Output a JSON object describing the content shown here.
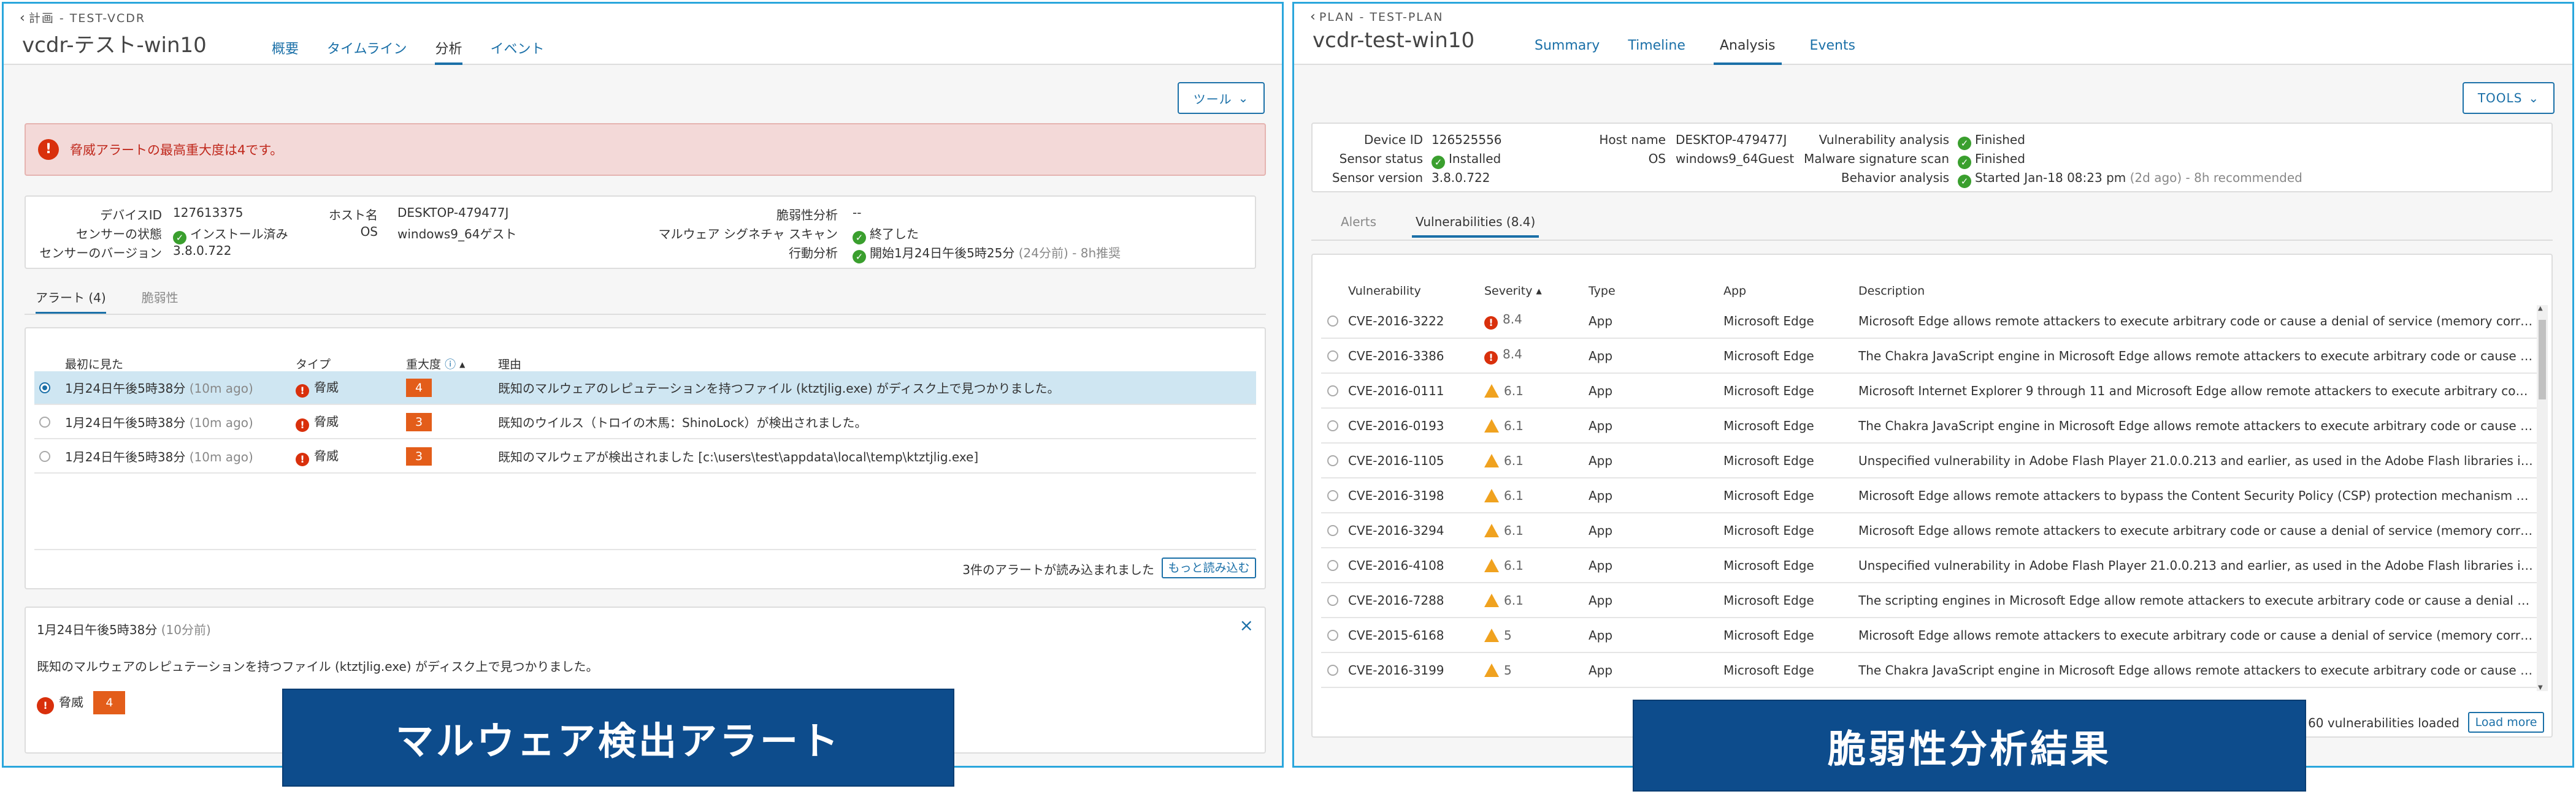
{
  "left": {
    "breadcrumb": "計画 - TEST-VCDR",
    "title": "vcdr-テスト-win10",
    "tabs": [
      "概要",
      "タイムライン",
      "分析",
      "イベント"
    ],
    "tools_label": "ツール",
    "alert_banner": "脅威アラートの最高重大度は4です。",
    "info": {
      "device_id_label": "デバイスID",
      "device_id": "127613375",
      "sensor_status_label": "センサーの状態",
      "sensor_status": "インストール済み",
      "sensor_version_label": "センサーのバージョン",
      "sensor_version": "3.8.0.722",
      "host_label": "ホスト名",
      "host": "DESKTOP-479477J",
      "os_label": "OS",
      "os": "windows9_64ゲスト",
      "vuln_label": "脆弱性分析",
      "vuln": "--",
      "malware_label": "マルウェア シグネチャ スキャン",
      "malware": "終了した",
      "behavior_label": "行動分析",
      "behavior": "開始1月24日午後5時25分",
      "behavior_ago": "(24分前)",
      "behavior_rec": " - 8h推奨"
    },
    "subtabs": [
      "アラート (4)",
      "脆弱性"
    ],
    "columns": [
      "最初に見た",
      "タイプ",
      "重大度",
      "理由"
    ],
    "rows": [
      {
        "time": "1月24日午後5時38分",
        "ago": "(10m ago)",
        "type": "脅威",
        "severity": "4",
        "reason": "既知のマルウェアのレピュテーションを持つファイル (ktztjlig.exe) がディスク上で見つかりました。"
      },
      {
        "time": "1月24日午後5時38分",
        "ago": "(10m ago)",
        "type": "脅威",
        "severity": "3",
        "reason": "既知のウイルス（トロイの木馬：ShinoLock）が検出されました。"
      },
      {
        "time": "1月24日午後5時38分",
        "ago": "(10m ago)",
        "type": "脅威",
        "severity": "3",
        "reason": "既知のマルウェアが検出されました [c:\\users\\test\\appdata\\local\\temp\\ktztjlig.exe]"
      }
    ],
    "loaded_text": "3件のアラートが読み込まれました",
    "load_more": "もっと読み込む",
    "detail": {
      "time": "1月24日午後5時38分",
      "ago": "(10分前)",
      "message": "既知のマルウェアのレピュテーションを持つファイル (ktztjlig.exe) がディスク上で見つかりました。",
      "type": "脅威",
      "severity": "4"
    },
    "caption": "マルウェア検出アラート"
  },
  "right": {
    "breadcrumb": "PLAN - TEST-PLAN",
    "title": "vcdr-test-win10",
    "tabs": [
      "Summary",
      "Timeline",
      "Analysis",
      "Events"
    ],
    "tools_label": "TOOLS",
    "info": {
      "device_id_label": "Device ID",
      "device_id": "126525556",
      "sensor_status_label": "Sensor status",
      "sensor_status": "Installed",
      "sensor_version_label": "Sensor version",
      "sensor_version": "3.8.0.722",
      "host_label": "Host name",
      "host": "DESKTOP-479477J",
      "os_label": "OS",
      "os": "windows9_64Guest",
      "vuln_label": "Vulnerability analysis",
      "vuln": "Finished",
      "malware_label": "Malware signature scan",
      "malware": "Finished",
      "behavior_label": "Behavior analysis",
      "behavior": "Started Jan-18 08:23 pm",
      "behavior_ago": "(2d ago)",
      "behavior_rec": " - 8h recommended"
    },
    "subtabs": [
      "Alerts",
      "Vulnerabilities (8.4)"
    ],
    "columns": [
      "Vulnerability",
      "Severity",
      "Type",
      "App",
      "Description"
    ],
    "rows": [
      {
        "cve": "CVE-2016-3222",
        "score": "8.4",
        "level": "critical",
        "type": "App",
        "app": "Microsoft Edge",
        "desc": "Microsoft Edge allows remote attackers to execute arbitrary code or cause a denial of service (memory corrup..."
      },
      {
        "cve": "CVE-2016-3386",
        "score": "8.4",
        "level": "critical",
        "type": "App",
        "app": "Microsoft Edge",
        "desc": "The Chakra JavaScript engine in Microsoft Edge allows remote attackers to execute arbitrary code or cause a ..."
      },
      {
        "cve": "CVE-2016-0111",
        "score": "6.1",
        "level": "warning",
        "type": "App",
        "app": "Microsoft Edge",
        "desc": "Microsoft Internet Explorer 9 through 11 and Microsoft Edge allow remote attackers to execute arbitrary code ..."
      },
      {
        "cve": "CVE-2016-0193",
        "score": "6.1",
        "level": "warning",
        "type": "App",
        "app": "Microsoft Edge",
        "desc": "The Chakra JavaScript engine in Microsoft Edge allows remote attackers to execute arbitrary code or cause a ..."
      },
      {
        "cve": "CVE-2016-1105",
        "score": "6.1",
        "level": "warning",
        "type": "App",
        "app": "Microsoft Edge",
        "desc": "Unspecified vulnerability in Adobe Flash Player 21.0.0.213 and earlier, as used in the Adobe Flash libraries in Mi..."
      },
      {
        "cve": "CVE-2016-3198",
        "score": "6.1",
        "level": "warning",
        "type": "App",
        "app": "Microsoft Edge",
        "desc": "Microsoft Edge allows remote attackers to bypass the Content Security Policy (CSP) protection mechanism via..."
      },
      {
        "cve": "CVE-2016-3294",
        "score": "6.1",
        "level": "warning",
        "type": "App",
        "app": "Microsoft Edge",
        "desc": "Microsoft Edge allows remote attackers to execute arbitrary code or cause a denial of service (memory corrup..."
      },
      {
        "cve": "CVE-2016-4108",
        "score": "6.1",
        "level": "warning",
        "type": "App",
        "app": "Microsoft Edge",
        "desc": "Unspecified vulnerability in Adobe Flash Player 21.0.0.213 and earlier, as used in the Adobe Flash libraries in Mi..."
      },
      {
        "cve": "CVE-2016-7288",
        "score": "6.1",
        "level": "warning",
        "type": "App",
        "app": "Microsoft Edge",
        "desc": "The scripting engines in Microsoft Edge allow remote attackers to execute arbitrary code or cause a denial of ..."
      },
      {
        "cve": "CVE-2015-6168",
        "score": "5",
        "level": "warning",
        "type": "App",
        "app": "Microsoft Edge",
        "desc": "Microsoft Edge allows remote attackers to execute arbitrary code or cause a denial of service (memory corrup..."
      },
      {
        "cve": "CVE-2016-3199",
        "score": "5",
        "level": "warning",
        "type": "App",
        "app": "Microsoft Edge",
        "desc": "The Chakra JavaScript engine in Microsoft Edge allows remote attackers to execute arbitrary code or cause a ..."
      }
    ],
    "loaded_text": "60 vulnerabilities loaded",
    "load_more": "Load more",
    "caption": "脆弱性分析結果"
  }
}
